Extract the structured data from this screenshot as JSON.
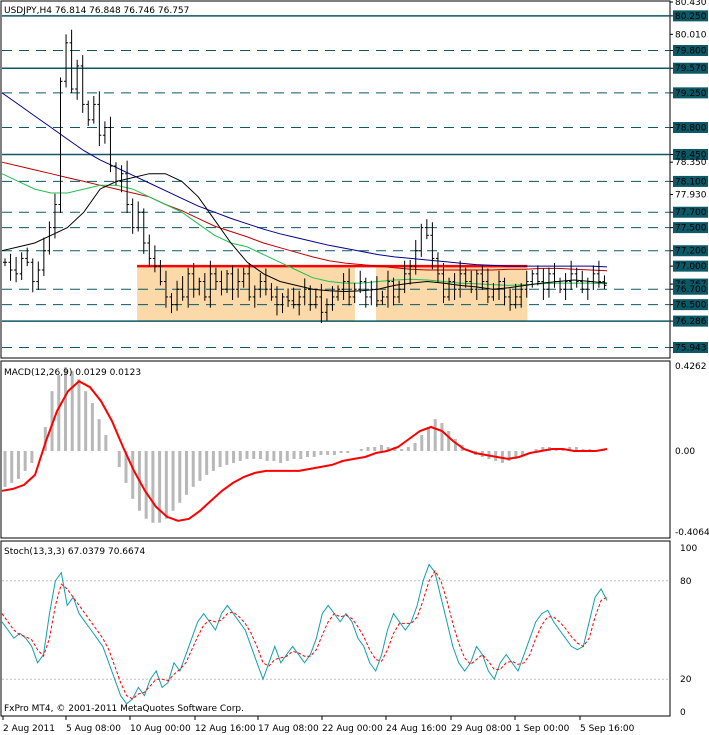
{
  "app": {
    "price_header": "USDJPY,H4  76.814 76.848 76.746 76.757",
    "macd_header": "MACD(12,26,9) 0.0129 0.0123",
    "stoch_header": "Stoch(13,3,3) 67.0379 70.6674",
    "copyright": "FxPro MT4, © 2001-2011 MetaQuotes Software Corp."
  },
  "colors": {
    "hline": "#0b5866",
    "zone": "#fbd9a8",
    "resistance": "#ff0000",
    "ma_fast": "#000000",
    "ma_mid": "#20c050",
    "ma_red": "#c00000",
    "ma_slow": "#00008b",
    "macd_signal": "#ff0000",
    "macd_hist": "#b8b8b8",
    "stoch_main": "#10a0b0",
    "stoch_signal": "#ff0000"
  },
  "chart_data": [
    {
      "type": "candlestick",
      "symbol": "USDJPY",
      "timeframe": "H4",
      "ylim": [
        75.82,
        80.43
      ],
      "axis_labels": [
        "80.430",
        "80.250",
        "80.010",
        "79.800",
        "79.570",
        "79.250",
        "78.800",
        "78.450",
        "78.350",
        "78.100",
        "77.930",
        "77.700",
        "77.500",
        "77.200",
        "77.000",
        "76.767",
        "76.700",
        "76.500",
        "76.286",
        "75.943"
      ],
      "axis_values": [
        80.43,
        80.25,
        80.01,
        79.8,
        79.57,
        79.25,
        78.8,
        78.45,
        78.35,
        78.1,
        77.93,
        77.7,
        77.5,
        77.2,
        77.0,
        76.767,
        76.7,
        76.5,
        76.286,
        75.943
      ],
      "highlighted_labels": [
        "80.250",
        "79.800",
        "79.570",
        "79.250",
        "78.800",
        "78.450",
        "78.100",
        "77.700",
        "77.500",
        "77.200",
        "77.000",
        "76.767",
        "76.700",
        "76.500",
        "76.286",
        "75.943"
      ],
      "horizontal_levels": [
        {
          "value": 80.25,
          "style": "solid"
        },
        {
          "value": 79.8,
          "style": "dashed"
        },
        {
          "value": 79.57,
          "style": "solid"
        },
        {
          "value": 79.25,
          "style": "dashed"
        },
        {
          "value": 78.8,
          "style": "dashed"
        },
        {
          "value": 78.45,
          "style": "solid"
        },
        {
          "value": 78.1,
          "style": "dashed"
        },
        {
          "value": 77.7,
          "style": "dashed"
        },
        {
          "value": 77.5,
          "style": "dashed"
        },
        {
          "value": 77.2,
          "style": "dashed"
        },
        {
          "value": 76.7,
          "style": "dashed"
        },
        {
          "value": 76.5,
          "style": "dashed"
        },
        {
          "value": 76.286,
          "style": "solid"
        },
        {
          "value": 75.943,
          "style": "dashed"
        }
      ],
      "resistance_level": 77.0,
      "range_zones": [
        {
          "x_from": 0.215,
          "x_to": 0.575,
          "low": 76.286,
          "high": 77.0
        },
        {
          "x_from": 0.61,
          "x_to": 0.86,
          "low": 76.286,
          "high": 77.0
        }
      ],
      "x_tick_labels": [
        "2 Aug 2011",
        "5 Aug 08:00",
        "10 Aug 00:00",
        "12 Aug 16:00",
        "17 Aug 08:00",
        "22 Aug 00:00",
        "24 Aug 16:00",
        "29 Aug 08:00",
        "1 Sep 00:00",
        "5 Sep 16:00"
      ],
      "closes": [
        77.05,
        76.95,
        76.9,
        77.1,
        77.05,
        76.8,
        76.95,
        77.2,
        77.5,
        77.8,
        79.4,
        79.9,
        79.3,
        79.6,
        79.1,
        78.9,
        79.1,
        78.7,
        78.8,
        78.3,
        78.1,
        78.2,
        77.8,
        77.5,
        77.7,
        77.3,
        77.1,
        77.0,
        76.8,
        76.6,
        76.5,
        76.7,
        76.6,
        76.9,
        76.7,
        76.8,
        76.6,
        76.9,
        76.8,
        76.7,
        76.9,
        76.7,
        76.8,
        76.9,
        76.6,
        76.7,
        76.8,
        76.7,
        76.6,
        76.5,
        76.6,
        76.55,
        76.5,
        76.6,
        76.7,
        76.5,
        76.6,
        76.4,
        76.5,
        76.6,
        76.7,
        76.8,
        76.6,
        76.7,
        76.8,
        76.6,
        76.7,
        76.55,
        76.6,
        76.8,
        76.6,
        76.7,
        76.9,
        77.0,
        77.2,
        77.5,
        77.4,
        77.1,
        76.9,
        76.6,
        76.8,
        76.7,
        76.9,
        76.8,
        76.7,
        76.9,
        76.8,
        76.6,
        76.7,
        76.8,
        76.6,
        76.5,
        76.6,
        76.7,
        76.8,
        76.9,
        76.8,
        76.7,
        76.9,
        76.8,
        76.7,
        76.8,
        76.9,
        76.8,
        76.7,
        76.8,
        76.9,
        76.8,
        76.75
      ],
      "ma_fast": [
        77.2,
        77.25,
        77.3,
        77.4,
        77.5,
        77.7,
        78.0,
        78.1,
        78.15,
        78.2,
        78.2,
        78.1,
        77.9,
        77.6,
        77.3,
        77.05,
        76.9,
        76.8,
        76.75,
        76.7,
        76.68,
        76.67,
        76.68,
        76.7,
        76.75,
        76.78,
        76.8,
        76.78,
        76.75,
        76.73,
        76.7,
        76.72,
        76.75,
        76.78,
        76.8,
        76.82,
        76.8,
        76.78
      ],
      "ma_mid": [
        78.2,
        78.1,
        78.0,
        77.95,
        77.95,
        78.0,
        78.05,
        78.05,
        78.0,
        77.9,
        77.8,
        77.7,
        77.55,
        77.4,
        77.3,
        77.25,
        77.15,
        77.05,
        76.95,
        76.85,
        76.8,
        76.78,
        76.78,
        76.8,
        76.82,
        76.83,
        76.82,
        76.8,
        76.78,
        76.77,
        76.76,
        76.75,
        76.76,
        76.77,
        76.78,
        76.78,
        76.78,
        76.77
      ],
      "ma_red": [
        78.35,
        78.3,
        78.25,
        78.2,
        78.15,
        78.1,
        78.05,
        78.0,
        77.95,
        77.9,
        77.8,
        77.72,
        77.62,
        77.52,
        77.45,
        77.38,
        77.3,
        77.24,
        77.18,
        77.12,
        77.07,
        77.04,
        77.02,
        77.0,
        76.98,
        76.96,
        76.95,
        76.95,
        76.95,
        76.95,
        76.95,
        76.96,
        76.96,
        76.97,
        76.97,
        76.96,
        76.95,
        76.94
      ],
      "ma_slow": [
        79.25,
        79.1,
        78.95,
        78.8,
        78.65,
        78.5,
        78.38,
        78.28,
        78.18,
        78.08,
        77.98,
        77.88,
        77.78,
        77.7,
        77.62,
        77.55,
        77.48,
        77.42,
        77.37,
        77.32,
        77.27,
        77.23,
        77.19,
        77.15,
        77.12,
        77.1,
        77.08,
        77.06,
        77.04,
        77.02,
        77.01,
        77.0,
        77.0,
        77.0,
        77.0,
        77.0,
        77.0,
        76.99
      ]
    },
    {
      "type": "histogram_line",
      "name": "MACD(12,26,9)",
      "ylim": [
        -0.4064,
        0.4262
      ],
      "axis_labels": [
        "0.4262",
        "0.00",
        "-0.4064"
      ],
      "axis_values": [
        0.4262,
        0.0,
        -0.4064
      ],
      "histogram": [
        -0.18,
        -0.16,
        -0.14,
        -0.1,
        -0.06,
        0.0,
        0.12,
        0.3,
        0.38,
        0.42,
        0.4,
        0.36,
        0.3,
        0.24,
        0.16,
        0.08,
        0.0,
        -0.08,
        -0.16,
        -0.24,
        -0.3,
        -0.34,
        -0.36,
        -0.36,
        -0.34,
        -0.3,
        -0.26,
        -0.22,
        -0.18,
        -0.15,
        -0.12,
        -0.1,
        -0.08,
        -0.07,
        -0.06,
        -0.05,
        -0.04,
        -0.04,
        -0.04,
        -0.05,
        -0.05,
        -0.06,
        -0.05,
        -0.04,
        -0.04,
        -0.03,
        -0.03,
        -0.02,
        -0.02,
        -0.02,
        -0.01,
        -0.01,
        0.0,
        0.01,
        0.02,
        0.02,
        0.03,
        0.02,
        0.02,
        0.01,
        0.02,
        0.04,
        0.08,
        0.12,
        0.16,
        0.14,
        0.1,
        0.06,
        0.03,
        0.0,
        -0.02,
        -0.03,
        -0.04,
        -0.05,
        -0.06,
        -0.05,
        -0.04,
        -0.02,
        0.0,
        0.01,
        0.02,
        0.02,
        0.01,
        0.01,
        0.02,
        0.02,
        0.01,
        0.01,
        0.0,
        0.01
      ],
      "signal": [
        -0.2,
        -0.19,
        -0.17,
        -0.12,
        0.05,
        0.2,
        0.3,
        0.35,
        0.32,
        0.25,
        0.15,
        0.02,
        -0.1,
        -0.2,
        -0.28,
        -0.33,
        -0.35,
        -0.34,
        -0.3,
        -0.25,
        -0.2,
        -0.16,
        -0.13,
        -0.11,
        -0.1,
        -0.1,
        -0.1,
        -0.1,
        -0.09,
        -0.08,
        -0.07,
        -0.05,
        -0.04,
        -0.03,
        -0.01,
        0.0,
        0.02,
        0.06,
        0.1,
        0.12,
        0.1,
        0.05,
        0.01,
        -0.01,
        -0.02,
        -0.03,
        -0.04,
        -0.03,
        -0.01,
        0.0,
        0.01,
        0.01,
        0.0,
        0.0,
        0.0,
        0.01
      ]
    },
    {
      "type": "line",
      "name": "Stoch(13,3,3)",
      "ylim": [
        0,
        100
      ],
      "axis_labels": [
        "100",
        "80",
        "20",
        "0"
      ],
      "axis_values": [
        100,
        80,
        20,
        0
      ],
      "main": [
        55,
        50,
        45,
        48,
        45,
        40,
        30,
        35,
        60,
        80,
        85,
        65,
        70,
        60,
        55,
        50,
        45,
        40,
        30,
        20,
        10,
        5,
        8,
        15,
        10,
        20,
        25,
        15,
        18,
        30,
        25,
        35,
        45,
        55,
        60,
        55,
        50,
        60,
        65,
        60,
        55,
        50,
        40,
        30,
        20,
        30,
        40,
        30,
        35,
        40,
        35,
        30,
        35,
        45,
        60,
        65,
        60,
        55,
        60,
        55,
        45,
        40,
        30,
        25,
        35,
        50,
        60,
        55,
        50,
        55,
        65,
        80,
        90,
        85,
        70,
        55,
        40,
        30,
        25,
        30,
        40,
        35,
        25,
        20,
        30,
        35,
        30,
        25,
        35,
        45,
        55,
        60,
        62,
        55,
        50,
        45,
        40,
        38,
        40,
        55,
        70,
        75,
        68
      ],
      "signal": [
        60,
        55,
        50,
        47,
        46,
        44,
        38,
        34,
        45,
        65,
        78,
        75,
        70,
        65,
        60,
        55,
        50,
        45,
        38,
        28,
        18,
        10,
        8,
        11,
        12,
        16,
        20,
        20,
        19,
        23,
        26,
        30,
        38,
        46,
        53,
        56,
        55,
        56,
        60,
        61,
        58,
        54,
        48,
        40,
        30,
        28,
        32,
        33,
        34,
        37,
        36,
        34,
        34,
        38,
        47,
        55,
        60,
        58,
        59,
        57,
        52,
        46,
        38,
        32,
        31,
        38,
        48,
        54,
        54,
        54,
        58,
        68,
        80,
        86,
        80,
        68,
        54,
        42,
        33,
        29,
        32,
        35,
        31,
        26,
        26,
        30,
        31,
        29,
        30,
        35,
        45,
        53,
        58,
        58,
        55,
        51,
        46,
        42,
        40,
        45,
        58,
        68,
        70
      ]
    }
  ]
}
